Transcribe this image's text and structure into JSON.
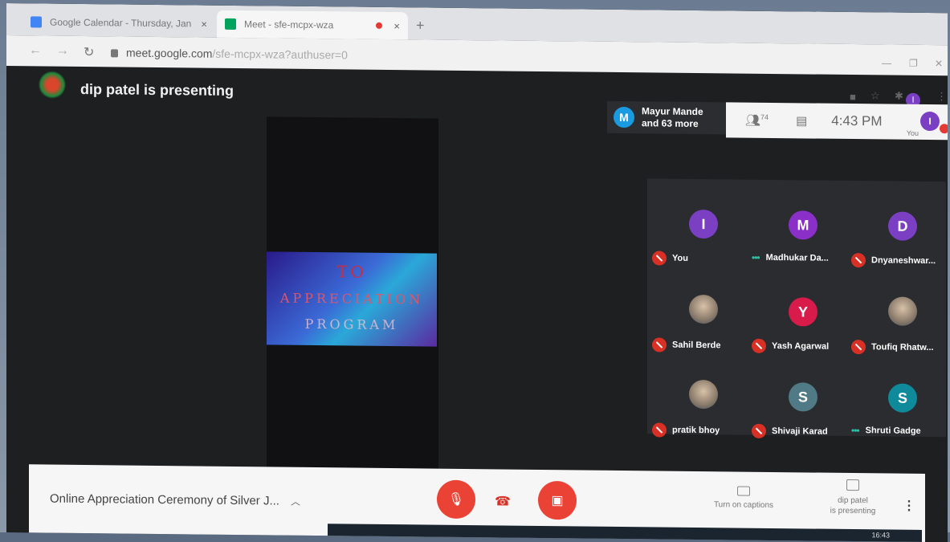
{
  "browser": {
    "tabs": [
      {
        "title": "Google Calendar - Thursday, Jan",
        "close": "×"
      },
      {
        "title": "Meet - sfe-mcpx-wza",
        "close": "×"
      }
    ],
    "new_tab": "+",
    "url_main": "meet.google.com",
    "url_rest": "/sfe-mcpx-wza?authuser=0",
    "profile_initial": "I"
  },
  "meet": {
    "presenting_title": "dip patel is presenting",
    "info_card": {
      "initial": "M",
      "line1": "Mayur Mande",
      "line2": "and 63 more"
    },
    "participant_count": "74",
    "time": "4:43 PM",
    "self_label": "You",
    "self_initial": "I",
    "slide": {
      "line1": "TO",
      "line2": "APPRECIATION",
      "line3": "PROGRAM"
    },
    "participants": [
      {
        "initial": "I",
        "name": "You",
        "color": "#7b3fc4",
        "status": "muted",
        "photo": false
      },
      {
        "initial": "M",
        "name": "Madhukar Da...",
        "color": "#8a2fc8",
        "status": "speaking",
        "photo": false
      },
      {
        "initial": "D",
        "name": "Dnyaneshwar...",
        "color": "#7b3fc4",
        "status": "muted",
        "photo": false
      },
      {
        "initial": "",
        "name": "Sahil Berde",
        "color": "",
        "status": "muted",
        "photo": true
      },
      {
        "initial": "Y",
        "name": "Yash Agarwal",
        "color": "#d81b4a",
        "status": "muted",
        "photo": false
      },
      {
        "initial": "",
        "name": "Toufiq Rhatw...",
        "color": "",
        "status": "muted",
        "photo": true
      },
      {
        "initial": "",
        "name": "pratik bhoy",
        "color": "",
        "status": "muted",
        "photo": true
      },
      {
        "initial": "S",
        "name": "Shivaji Karad",
        "color": "#4f7a86",
        "status": "muted",
        "photo": false
      },
      {
        "initial": "S",
        "name": "Shruti Gadge",
        "color": "#0f8a9a",
        "status": "speaking",
        "photo": false
      }
    ],
    "bottom": {
      "meeting_title": "Online Appreciation Ceremony of Silver J...",
      "captions_label": "Turn on captions",
      "presenting_line1": "dip patel",
      "presenting_line2": "is presenting",
      "more": "⋮"
    },
    "taskbar_time": "16:43"
  },
  "colors": {
    "accent_red": "#ea4335",
    "meet_bg": "#1e1f21",
    "tile_bg": "#2b2c30"
  }
}
